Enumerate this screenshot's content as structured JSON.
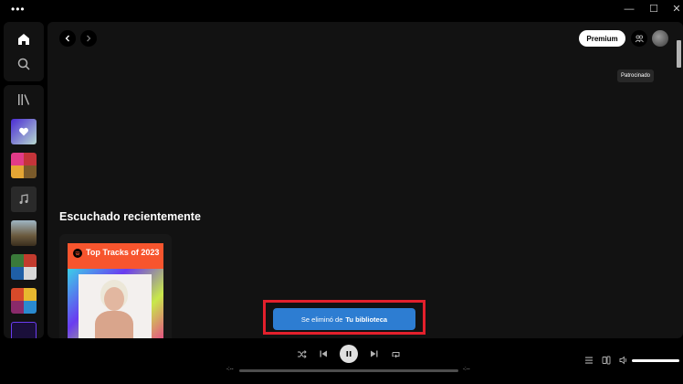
{
  "titlebar": {
    "menu_dots": "•••",
    "minimize": "—",
    "maximize": "☐",
    "close": "✕"
  },
  "topbar": {
    "premium_label": "Premium",
    "tooltip": "Patrocinado"
  },
  "main": {
    "section_title": "Escuchado recientemente"
  },
  "card": {
    "cover_title": "Top Tracks of 2023"
  },
  "toast": {
    "text": "Se eliminó de",
    "bold": "Tu biblioteca"
  },
  "player": {
    "time_elapsed": "-:--",
    "time_total": "-:--",
    "volume_level": 1.0,
    "progress": 0.0
  },
  "colors": {
    "toast_bg": "#2d7dd2",
    "highlight_border": "#e3202c",
    "cover_bg": "#f7552e",
    "liked_gradient": "#7b5cf0"
  },
  "icons": [
    "home-icon",
    "search-icon",
    "library-icon",
    "liked-songs-icon",
    "music-note-icon",
    "back-icon",
    "forward-icon",
    "friends-icon",
    "shuffle-icon",
    "previous-icon",
    "pause-icon",
    "next-icon",
    "repeat-icon",
    "queue-icon",
    "devices-icon",
    "volume-icon"
  ]
}
